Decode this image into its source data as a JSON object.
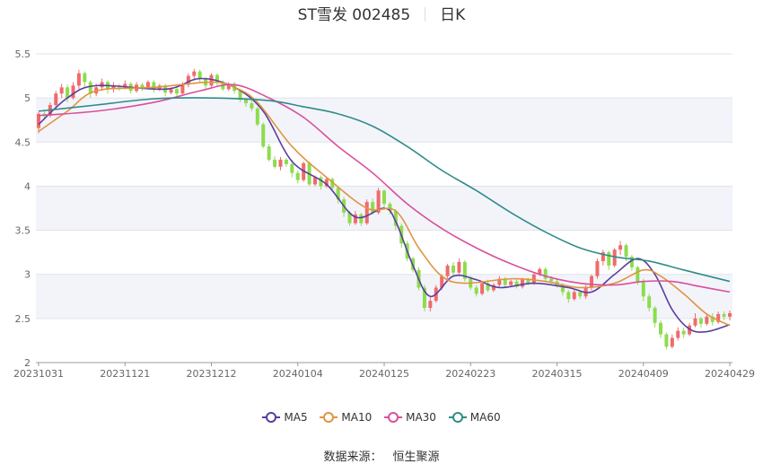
{
  "title": {
    "stock": "ST雪发 002485",
    "period": "日K"
  },
  "source_label": "数据来源：",
  "source_value": "恒生聚源",
  "colors": {
    "up": "#ef6b6b",
    "down": "#8ddc4e",
    "ma5": "#5b3d9e",
    "ma10": "#e09440",
    "ma30": "#d9509c",
    "ma60": "#2f8c8a",
    "band": "#f3f4fa",
    "grid": "#e0e3ea",
    "axis": "#666666"
  },
  "chart_data": {
    "type": "candlestick",
    "title": "ST雪发 002485 日K",
    "ylim": [
      2,
      5.5
    ],
    "yticks": [
      "2",
      "2.5",
      "3",
      "3.5",
      "4",
      "4.5",
      "5",
      "5.5"
    ],
    "xtick_labels": [
      "20231031",
      "20231121",
      "20231212",
      "20240104",
      "20240125",
      "20240223",
      "20240315",
      "20240409",
      "20240429"
    ],
    "xtick_index": [
      0,
      15,
      30,
      45,
      60,
      75,
      90,
      105,
      120
    ],
    "n_days": 121,
    "legend": [
      "MA5",
      "MA10",
      "MA30",
      "MA60"
    ],
    "ohlc": [
      [
        4.66,
        4.82,
        4.6,
        4.84
      ],
      [
        4.82,
        4.8,
        4.75,
        4.86
      ],
      [
        4.8,
        4.92,
        4.78,
        4.95
      ],
      [
        4.92,
        5.05,
        4.88,
        5.08
      ],
      [
        5.05,
        5.12,
        5.0,
        5.16
      ],
      [
        5.12,
        5.0,
        4.95,
        5.15
      ],
      [
        5.0,
        5.14,
        4.98,
        5.18
      ],
      [
        5.14,
        5.28,
        5.1,
        5.32
      ],
      [
        5.28,
        5.18,
        5.12,
        5.3
      ],
      [
        5.18,
        5.05,
        5.0,
        5.2
      ],
      [
        5.05,
        5.12,
        5.02,
        5.16
      ],
      [
        5.12,
        5.18,
        5.08,
        5.22
      ],
      [
        5.18,
        5.1,
        5.05,
        5.2
      ],
      [
        5.1,
        5.14,
        5.06,
        5.18
      ],
      [
        5.14,
        5.12,
        5.08,
        5.16
      ],
      [
        5.12,
        5.16,
        5.1,
        5.2
      ],
      [
        5.16,
        5.08,
        5.05,
        5.18
      ],
      [
        5.08,
        5.15,
        5.06,
        5.18
      ],
      [
        5.15,
        5.12,
        5.08,
        5.17
      ],
      [
        5.12,
        5.18,
        5.1,
        5.2
      ],
      [
        5.18,
        5.1,
        5.06,
        5.2
      ],
      [
        5.1,
        5.14,
        5.08,
        5.16
      ],
      [
        5.14,
        5.06,
        5.02,
        5.16
      ],
      [
        5.06,
        5.1,
        5.04,
        5.12
      ],
      [
        5.1,
        5.05,
        5.02,
        5.12
      ],
      [
        5.05,
        5.15,
        5.04,
        5.18
      ],
      [
        5.15,
        5.25,
        5.12,
        5.28
      ],
      [
        5.25,
        5.3,
        5.2,
        5.33
      ],
      [
        5.3,
        5.22,
        5.18,
        5.32
      ],
      [
        5.22,
        5.14,
        5.1,
        5.24
      ],
      [
        5.14,
        5.26,
        5.12,
        5.28
      ],
      [
        5.26,
        5.18,
        5.14,
        5.28
      ],
      [
        5.18,
        5.1,
        5.08,
        5.2
      ],
      [
        5.1,
        5.16,
        5.08,
        5.18
      ],
      [
        5.16,
        5.08,
        5.05,
        5.18
      ],
      [
        5.08,
        4.98,
        4.95,
        5.1
      ],
      [
        4.98,
        4.94,
        4.9,
        5.0
      ],
      [
        4.94,
        4.88,
        4.85,
        4.98
      ],
      [
        4.88,
        4.7,
        4.68,
        4.9
      ],
      [
        4.7,
        4.45,
        4.43,
        4.72
      ],
      [
        4.45,
        4.3,
        4.28,
        4.48
      ],
      [
        4.3,
        4.22,
        4.2,
        4.34
      ],
      [
        4.22,
        4.3,
        4.18,
        4.33
      ],
      [
        4.3,
        4.25,
        4.22,
        4.32
      ],
      [
        4.25,
        4.15,
        4.1,
        4.3
      ],
      [
        4.15,
        4.07,
        4.03,
        4.18
      ],
      [
        4.07,
        4.26,
        4.05,
        4.28
      ],
      [
        4.26,
        4.02,
        4.0,
        4.28
      ],
      [
        4.02,
        4.1,
        4.0,
        4.12
      ],
      [
        4.1,
        4.0,
        3.96,
        4.12
      ],
      [
        4.0,
        4.08,
        3.98,
        4.1
      ],
      [
        4.08,
        3.98,
        3.94,
        4.1
      ],
      [
        3.98,
        3.85,
        3.8,
        4.0
      ],
      [
        3.85,
        3.7,
        3.65,
        3.88
      ],
      [
        3.7,
        3.58,
        3.55,
        3.72
      ],
      [
        3.58,
        3.68,
        3.56,
        3.72
      ],
      [
        3.68,
        3.58,
        3.55,
        3.7
      ],
      [
        3.58,
        3.82,
        3.56,
        3.85
      ],
      [
        3.82,
        3.7,
        3.68,
        3.86
      ],
      [
        3.7,
        3.95,
        3.68,
        3.98
      ],
      [
        3.95,
        3.8,
        3.76,
        3.96
      ],
      [
        3.8,
        3.72,
        3.68,
        3.82
      ],
      [
        3.72,
        3.55,
        3.5,
        3.74
      ],
      [
        3.55,
        3.35,
        3.3,
        3.58
      ],
      [
        3.35,
        3.18,
        3.15,
        3.38
      ],
      [
        3.18,
        3.05,
        3.02,
        3.2
      ],
      [
        3.05,
        2.85,
        2.82,
        3.08
      ],
      [
        2.85,
        2.62,
        2.58,
        2.88
      ],
      [
        2.62,
        2.7,
        2.58,
        2.74
      ],
      [
        2.7,
        2.85,
        2.68,
        2.88
      ],
      [
        2.85,
        2.98,
        2.82,
        3.0
      ],
      [
        2.98,
        3.1,
        2.95,
        3.12
      ],
      [
        3.1,
        3.02,
        2.98,
        3.14
      ],
      [
        3.02,
        3.14,
        3.0,
        3.18
      ],
      [
        3.14,
        2.95,
        2.92,
        3.16
      ],
      [
        2.95,
        2.85,
        2.82,
        2.98
      ],
      [
        2.85,
        2.78,
        2.75,
        2.88
      ],
      [
        2.78,
        2.9,
        2.76,
        2.92
      ],
      [
        2.9,
        2.82,
        2.8,
        2.94
      ],
      [
        2.82,
        2.88,
        2.8,
        2.9
      ],
      [
        2.88,
        2.95,
        2.86,
        2.98
      ],
      [
        2.95,
        2.88,
        2.85,
        2.97
      ],
      [
        2.88,
        2.92,
        2.86,
        2.94
      ],
      [
        2.92,
        2.86,
        2.84,
        2.94
      ],
      [
        2.86,
        2.94,
        2.84,
        2.96
      ],
      [
        2.94,
        2.9,
        2.88,
        2.96
      ],
      [
        2.9,
        3.0,
        2.88,
        3.02
      ],
      [
        3.0,
        3.06,
        2.98,
        3.08
      ],
      [
        3.06,
        2.95,
        2.92,
        3.08
      ],
      [
        2.95,
        2.92,
        2.9,
        2.98
      ],
      [
        2.92,
        2.88,
        2.85,
        2.95
      ],
      [
        2.88,
        2.8,
        2.76,
        2.9
      ],
      [
        2.8,
        2.72,
        2.68,
        2.82
      ],
      [
        2.72,
        2.8,
        2.7,
        2.84
      ],
      [
        2.8,
        2.75,
        2.72,
        2.82
      ],
      [
        2.75,
        2.85,
        2.72,
        2.88
      ],
      [
        2.85,
        2.98,
        2.82,
        3.0
      ],
      [
        2.98,
        3.15,
        2.95,
        3.18
      ],
      [
        3.15,
        3.25,
        3.1,
        3.28
      ],
      [
        3.25,
        3.1,
        3.05,
        3.27
      ],
      [
        3.1,
        3.28,
        3.08,
        3.3
      ],
      [
        3.28,
        3.33,
        3.22,
        3.38
      ],
      [
        3.33,
        3.2,
        3.15,
        3.35
      ],
      [
        3.2,
        3.08,
        3.04,
        3.22
      ],
      [
        3.08,
        2.92,
        2.88,
        3.1
      ],
      [
        2.92,
        2.75,
        2.7,
        2.95
      ],
      [
        2.75,
        2.62,
        2.58,
        2.78
      ],
      [
        2.62,
        2.45,
        2.4,
        2.64
      ],
      [
        2.45,
        2.32,
        2.28,
        2.48
      ],
      [
        2.32,
        2.18,
        2.15,
        2.34
      ],
      [
        2.18,
        2.28,
        2.16,
        2.32
      ],
      [
        2.28,
        2.36,
        2.25,
        2.4
      ],
      [
        2.36,
        2.32,
        2.28,
        2.4
      ],
      [
        2.32,
        2.42,
        2.3,
        2.45
      ],
      [
        2.42,
        2.5,
        2.4,
        2.56
      ],
      [
        2.5,
        2.44,
        2.4,
        2.52
      ],
      [
        2.44,
        2.52,
        2.42,
        2.56
      ],
      [
        2.52,
        2.46,
        2.42,
        2.56
      ],
      [
        2.46,
        2.55,
        2.44,
        2.58
      ],
      [
        2.55,
        2.52,
        2.48,
        2.58
      ],
      [
        2.52,
        2.56,
        2.48,
        2.59
      ]
    ],
    "ma_anchors": {
      "MA5": [
        [
          0,
          4.7
        ],
        [
          5,
          5.0
        ],
        [
          10,
          5.14
        ],
        [
          22,
          5.1
        ],
        [
          28,
          5.22
        ],
        [
          34,
          5.12
        ],
        [
          39,
          4.85
        ],
        [
          44,
          4.28
        ],
        [
          50,
          4.02
        ],
        [
          55,
          3.65
        ],
        [
          60,
          3.75
        ],
        [
          62,
          3.6
        ],
        [
          65,
          3.1
        ],
        [
          68,
          2.75
        ],
        [
          72,
          2.98
        ],
        [
          76,
          2.94
        ],
        [
          80,
          2.85
        ],
        [
          86,
          2.9
        ],
        [
          92,
          2.85
        ],
        [
          96,
          2.8
        ],
        [
          100,
          3.0
        ],
        [
          104,
          3.18
        ],
        [
          107,
          3.0
        ],
        [
          110,
          2.6
        ],
        [
          113,
          2.38
        ],
        [
          116,
          2.35
        ],
        [
          120,
          2.43
        ]
      ],
      "MA10": [
        [
          0,
          4.62
        ],
        [
          5,
          4.85
        ],
        [
          10,
          5.08
        ],
        [
          20,
          5.12
        ],
        [
          30,
          5.18
        ],
        [
          34,
          5.12
        ],
        [
          38,
          4.95
        ],
        [
          44,
          4.45
        ],
        [
          50,
          4.1
        ],
        [
          57,
          3.75
        ],
        [
          62,
          3.72
        ],
        [
          66,
          3.3
        ],
        [
          70,
          2.98
        ],
        [
          74,
          2.9
        ],
        [
          82,
          2.95
        ],
        [
          88,
          2.92
        ],
        [
          94,
          2.85
        ],
        [
          100,
          2.9
        ],
        [
          105,
          3.05
        ],
        [
          108,
          2.98
        ],
        [
          112,
          2.78
        ],
        [
          116,
          2.55
        ],
        [
          120,
          2.42
        ]
      ],
      "MA30": [
        [
          0,
          4.8
        ],
        [
          10,
          4.85
        ],
        [
          20,
          4.95
        ],
        [
          28,
          5.08
        ],
        [
          34,
          5.15
        ],
        [
          40,
          5.0
        ],
        [
          46,
          4.78
        ],
        [
          52,
          4.45
        ],
        [
          58,
          4.15
        ],
        [
          64,
          3.8
        ],
        [
          70,
          3.52
        ],
        [
          76,
          3.3
        ],
        [
          82,
          3.12
        ],
        [
          88,
          2.98
        ],
        [
          94,
          2.9
        ],
        [
          100,
          2.88
        ],
        [
          105,
          2.92
        ],
        [
          110,
          2.92
        ],
        [
          115,
          2.86
        ],
        [
          120,
          2.8
        ]
      ],
      "MA60": [
        [
          0,
          4.85
        ],
        [
          10,
          4.92
        ],
        [
          20,
          4.99
        ],
        [
          30,
          5.0
        ],
        [
          40,
          4.97
        ],
        [
          46,
          4.9
        ],
        [
          52,
          4.82
        ],
        [
          58,
          4.68
        ],
        [
          64,
          4.45
        ],
        [
          70,
          4.18
        ],
        [
          76,
          3.95
        ],
        [
          82,
          3.7
        ],
        [
          88,
          3.48
        ],
        [
          94,
          3.3
        ],
        [
          100,
          3.2
        ],
        [
          106,
          3.15
        ],
        [
          112,
          3.05
        ],
        [
          120,
          2.92
        ]
      ]
    }
  }
}
